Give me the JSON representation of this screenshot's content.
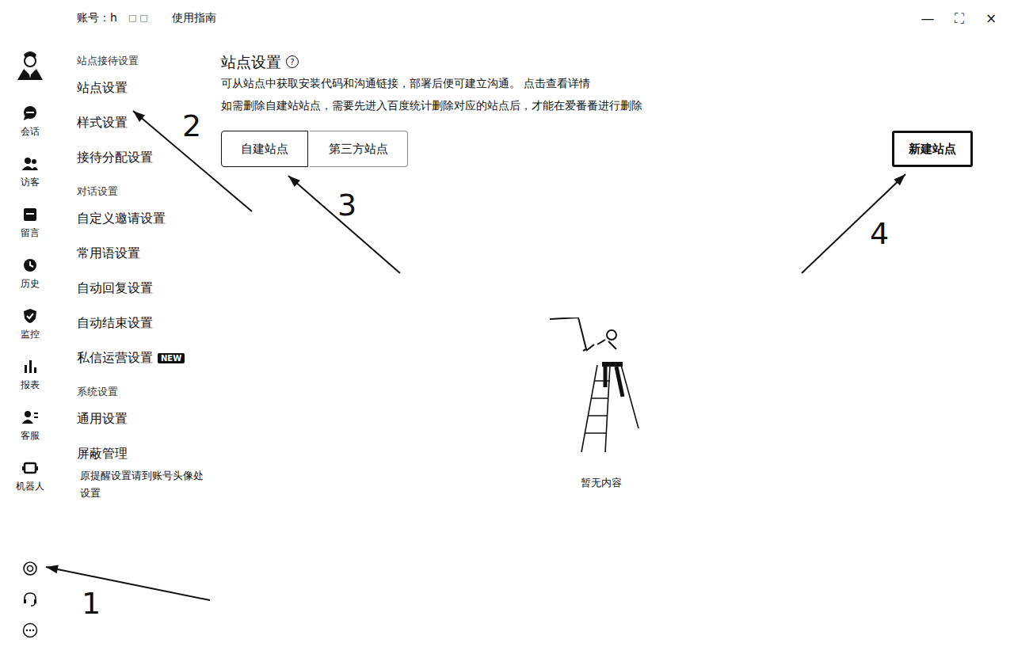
{
  "header": {
    "account_label": "账号：h",
    "account_masked": "□□",
    "guide_link": "使用指南",
    "window_controls": [
      "—",
      "⛶",
      "×"
    ]
  },
  "rail": {
    "items": [
      {
        "label": "会话"
      },
      {
        "label": "访客"
      },
      {
        "label": "留言"
      },
      {
        "label": "历史"
      },
      {
        "label": "监控"
      },
      {
        "label": "报表"
      },
      {
        "label": "客服"
      },
      {
        "label": "机器人"
      }
    ]
  },
  "nav": {
    "sections": [
      {
        "title": "站点接待设置",
        "items": [
          {
            "label": "站点设置",
            "badge": ""
          },
          {
            "label": "样式设置",
            "badge": ""
          },
          {
            "label": "接待分配设置",
            "badge": ""
          }
        ]
      },
      {
        "title": "对话设置",
        "items": [
          {
            "label": "自定义邀请设置",
            "badge": ""
          },
          {
            "label": "常用语设置",
            "badge": ""
          },
          {
            "label": "自动回复设置",
            "badge": ""
          },
          {
            "label": "自动结束设置",
            "badge": ""
          },
          {
            "label": "私信运营设置",
            "badge": "NEW"
          }
        ]
      },
      {
        "title": "系统设置",
        "items": [
          {
            "label": "通用设置",
            "badge": ""
          },
          {
            "label": "屏蔽管理",
            "badge": ""
          }
        ]
      }
    ],
    "note": "原提醒设置请到账号头像处设置"
  },
  "main": {
    "title": "站点设置",
    "help_icon": "?",
    "description": [
      "可从站点中获取安装代码和沟通链接，部署后便可建立沟通。 点击查看详情",
      "如需删除自建站站点，需要先进入百度统计删除对应的站点后，才能在爱番番进行删除"
    ],
    "tabs": [
      {
        "label": "自建站点",
        "selected": true
      },
      {
        "label": "第三方站点",
        "selected": false
      }
    ],
    "new_button": "新建站点",
    "empty_text": "暂无内容"
  },
  "annotations": [
    {
      "label": "1"
    },
    {
      "label": "2"
    },
    {
      "label": "3"
    },
    {
      "label": "4"
    }
  ]
}
